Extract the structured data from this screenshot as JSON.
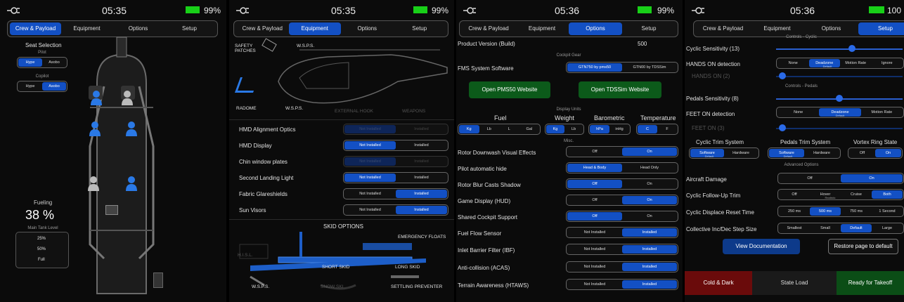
{
  "panels": [
    {
      "clock": "05:35",
      "battery": "99%",
      "tabs": [
        "Crew & Payload",
        "Equipment",
        "Options",
        "Setup"
      ],
      "seat_selection": "Seat Selection",
      "pilot": {
        "label": "Pilot",
        "options": [
          "Hype",
          "Asobo"
        ],
        "selected": 0
      },
      "copilot": {
        "label": "Copilot",
        "options": [
          "Hype",
          "Asobo"
        ],
        "selected": 1
      },
      "fueling": "Fueling",
      "fuel_pct": "38 %",
      "main_tank": "Main Tank Level",
      "fuel_levels": [
        "25%",
        "50%",
        "Full"
      ]
    },
    {
      "clock": "05:35",
      "battery": "99%",
      "tabs": [
        "Crew & Payload",
        "Equipment",
        "Options",
        "Setup"
      ],
      "labels": {
        "safety": "SAFETY PATCHES",
        "wsps_top": "W.S.P.S.",
        "radome": "RADOME",
        "wsps_bottom": "W.S.P.S.",
        "hook": "EXTERNAL HOOK",
        "weapons": "WEAPONS"
      },
      "rows": [
        {
          "label": "HMD Alignment Optics",
          "options": [
            "Not Installed",
            "Installed"
          ],
          "selected": 0,
          "disabled": true
        },
        {
          "label": "HMD Display",
          "options": [
            "Not Installed",
            "Installed"
          ],
          "selected": 0
        },
        {
          "label": "Chin window plates",
          "options": [
            "Not Installed",
            "Installed"
          ],
          "selected": 0,
          "disabled": true
        },
        {
          "label": "Second Landing Light",
          "options": [
            "Not Installed",
            "Installed"
          ],
          "selected": 0
        },
        {
          "label": "Fabric Glareshields",
          "options": [
            "Not Installed",
            "Installed"
          ],
          "selected": 1
        },
        {
          "label": "Sun Visors",
          "options": [
            "Not Installed",
            "Installed"
          ],
          "selected": 1
        }
      ],
      "skid": {
        "title": "SKID OPTIONS",
        "floats": "EMERGENCY FLOATS",
        "hisl": "H.I.S.L.",
        "short": "SHORT SKID",
        "long": "LONG SKID",
        "wsps": "W.S.P.S.",
        "snow": "SNOW SKI",
        "settling": "SETTLING PREVENTER"
      }
    },
    {
      "clock": "05:36",
      "battery": "99%",
      "tabs": [
        "Crew & Payload",
        "Equipment",
        "Options",
        "Setup"
      ],
      "product_version_label": "Product Version (Build)",
      "product_version": "500",
      "cockpit_gear": "Cockpit Gear",
      "fms_label": "FMS System Software",
      "fms": {
        "options": [
          "GTN750 by pms50",
          "GTN00 by TDSSim"
        ],
        "selected": 0
      },
      "pms_btn": "Open PMS50 Website",
      "tds_btn": "Open TDSSim Website",
      "display_units": "Display Units",
      "units": [
        {
          "label": "Fuel",
          "options": [
            "Kg",
            "Lb",
            "L",
            "Gal"
          ],
          "selected": 0
        },
        {
          "label": "Weight",
          "options": [
            "Kg",
            "Lb"
          ],
          "selected": 0
        },
        {
          "label": "Barometric",
          "options": [
            "hPa",
            "inHg"
          ],
          "selected": 0
        },
        {
          "label": "Temperature",
          "options": [
            "C",
            "F"
          ],
          "selected": 0
        }
      ],
      "misc": "Misc.",
      "rows": [
        {
          "label": "Rotor Downwash Visual Effects",
          "options": [
            "Off",
            "On"
          ],
          "selected": 1
        },
        {
          "label": "Pilot automatic hide",
          "options": [
            "Head & Body",
            "Head Only"
          ],
          "selected": 0
        },
        {
          "label": "Rotor Blur Casts Shadow",
          "options": [
            "Off",
            "On"
          ],
          "selected": 0
        },
        {
          "label": "Game Display (HUD)",
          "options": [
            "Off",
            "On"
          ],
          "selected": 1
        },
        {
          "label": "Shared Cockpit Support",
          "options": [
            "Off",
            "On"
          ],
          "selected": 0
        },
        {
          "label": "Fuel Flow Sensor",
          "options": [
            "Not Installed",
            "Installed"
          ],
          "selected": 1
        },
        {
          "label": "Inlet Barrier Filter (IBF)",
          "options": [
            "Not Installed",
            "Installed"
          ],
          "selected": 1
        },
        {
          "label": "Anti-collision (ACAS)",
          "options": [
            "Not Installed",
            "Installed"
          ],
          "selected": 1
        },
        {
          "label": "Terrain Awareness (HTAWS)",
          "options": [
            "Not Installed",
            "Installed"
          ],
          "selected": 1
        }
      ]
    },
    {
      "clock": "05:36",
      "battery": "100",
      "tabs": [
        "Crew & Payload",
        "Equipment",
        "Options",
        "Setup"
      ],
      "controls_cyclic": "Controls - Cyclic",
      "cyclic_sens": "Cyclic Sensitivity (13)",
      "cyclic_sens_level": 0.6,
      "hands_on_label": "HANDS ON detection",
      "hands_on": {
        "options": [
          "None",
          "Deadzone",
          "Motion Rate",
          "Ignore"
        ],
        "selected": 1,
        "sub": "Default"
      },
      "hands_on_value": "HANDS ON (2)",
      "hands_on_level": 0.05,
      "controls_pedals": "Controls - Pedals",
      "pedals_sens": "Pedals Sensitivity (8)",
      "pedals_sens_level": 0.5,
      "feet_on_label": "FEET ON detection",
      "feet_on": {
        "options": [
          "None",
          "Deadzone",
          "Motion Rate"
        ],
        "selected": 1,
        "sub": "Default"
      },
      "feet_on_value": "FEET ON (3)",
      "feet_on_level": 0.05,
      "trim_headers": [
        "Cyclic Trim System",
        "Pedals Trim System",
        "Vortex Ring State"
      ],
      "cyclic_trim": {
        "options": [
          "Software",
          "Hardware"
        ],
        "selected": 0,
        "sub": "Default"
      },
      "pedals_trim": {
        "options": [
          "Software",
          "Hardware"
        ],
        "selected": 0,
        "sub": "Default"
      },
      "vortex": {
        "options": [
          "Off",
          "On"
        ],
        "selected": 1
      },
      "advanced": "Advanced Options",
      "rows": [
        {
          "label": "Aircraft Damage",
          "options": [
            "Off",
            "On"
          ],
          "selected": 1
        },
        {
          "label": "Cyclic Follow-Up Trim",
          "options": [
            "Off",
            "Hover",
            "Cruise",
            "Both"
          ],
          "selected": 3,
          "sub": "Realistic"
        },
        {
          "label": "Cyclic Displace Reset Time",
          "options": [
            "250 ms",
            "500 ms",
            "750 ms",
            "1 Second"
          ],
          "selected": 1
        },
        {
          "label": "Collective Inc/Dec Step Size",
          "options": [
            "Smallest",
            "Small",
            "Default",
            "Large"
          ],
          "selected": 2
        }
      ],
      "view_docs": "View Documentation",
      "restore": "Restore page to default",
      "cold_dark": "Cold & Dark",
      "state_load": "State Load",
      "ready": "Ready for Takeoff"
    }
  ]
}
